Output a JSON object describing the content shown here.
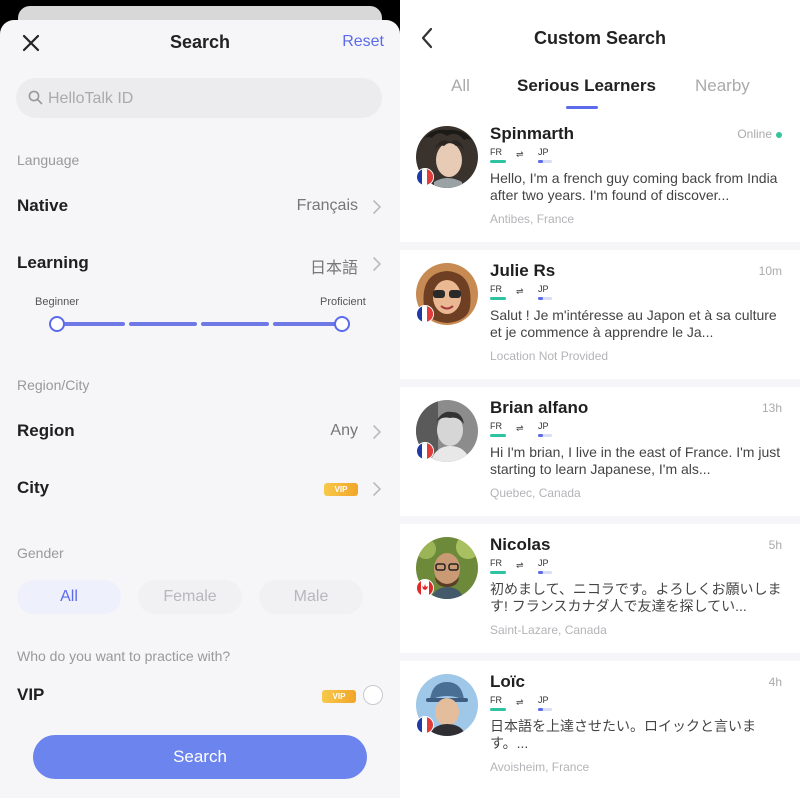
{
  "filter_sheet": {
    "title": "Search",
    "reset_label": "Reset",
    "search_placeholder": "HelloTalk ID",
    "language_section": "Language",
    "native_label": "Native",
    "native_value": "Français",
    "learning_label": "Learning",
    "learning_value": "日本語",
    "slider_min_label": "Beginner",
    "slider_max_label": "Proficient",
    "region_section": "Region/City",
    "region_label": "Region",
    "region_value": "Any",
    "city_label": "City",
    "vip_badge_label": "VIP",
    "gender_section": "Gender",
    "gender_options": [
      "All",
      "Female",
      "Male"
    ],
    "gender_selected": "All",
    "practice_section": "Who do you want to practice with?",
    "vip_label": "VIP",
    "vip_checked": false,
    "search_button": "Search",
    "accent_color": "#5b6bea"
  },
  "results": {
    "title": "Custom Search",
    "tabs": [
      "All",
      "Serious Learners",
      "Nearby"
    ],
    "active_tab": "Serious Learners",
    "users": [
      {
        "name": "Spinmarth",
        "status": "Online",
        "native": "FR",
        "learning": "JP",
        "bio": "Hello, I'm a french guy coming back from India after two years. I'm found of discover...",
        "location": "Antibes, France",
        "flag": "fr"
      },
      {
        "name": "Julie Rs",
        "status": "10m",
        "native": "FR",
        "learning": "JP",
        "bio": "Salut ! Je m'intéresse au Japon et à sa culture et je commence à apprendre le Ja...",
        "location": "Location Not Provided",
        "flag": "fr"
      },
      {
        "name": "Brian alfano",
        "status": "13h",
        "native": "FR",
        "learning": "JP",
        "bio": "Hi I'm brian, I live in the east of France. I'm just starting to learn Japanese, I'm als...",
        "location": "Quebec, Canada",
        "flag": "fr"
      },
      {
        "name": "Nicolas",
        "status": "5h",
        "native": "FR",
        "learning": "JP",
        "bio": "初めまして、ニコラです。よろしくお願いします! フランスカナダ人で友達を探してい...",
        "location": "Saint-Lazare, Canada",
        "flag": "ca"
      },
      {
        "name": "Loïc",
        "status": "4h",
        "native": "FR",
        "learning": "JP",
        "bio": "日本語を上達させたい。ロイックと言います。...",
        "location": "Avoisheim, France",
        "flag": "fr"
      }
    ]
  }
}
